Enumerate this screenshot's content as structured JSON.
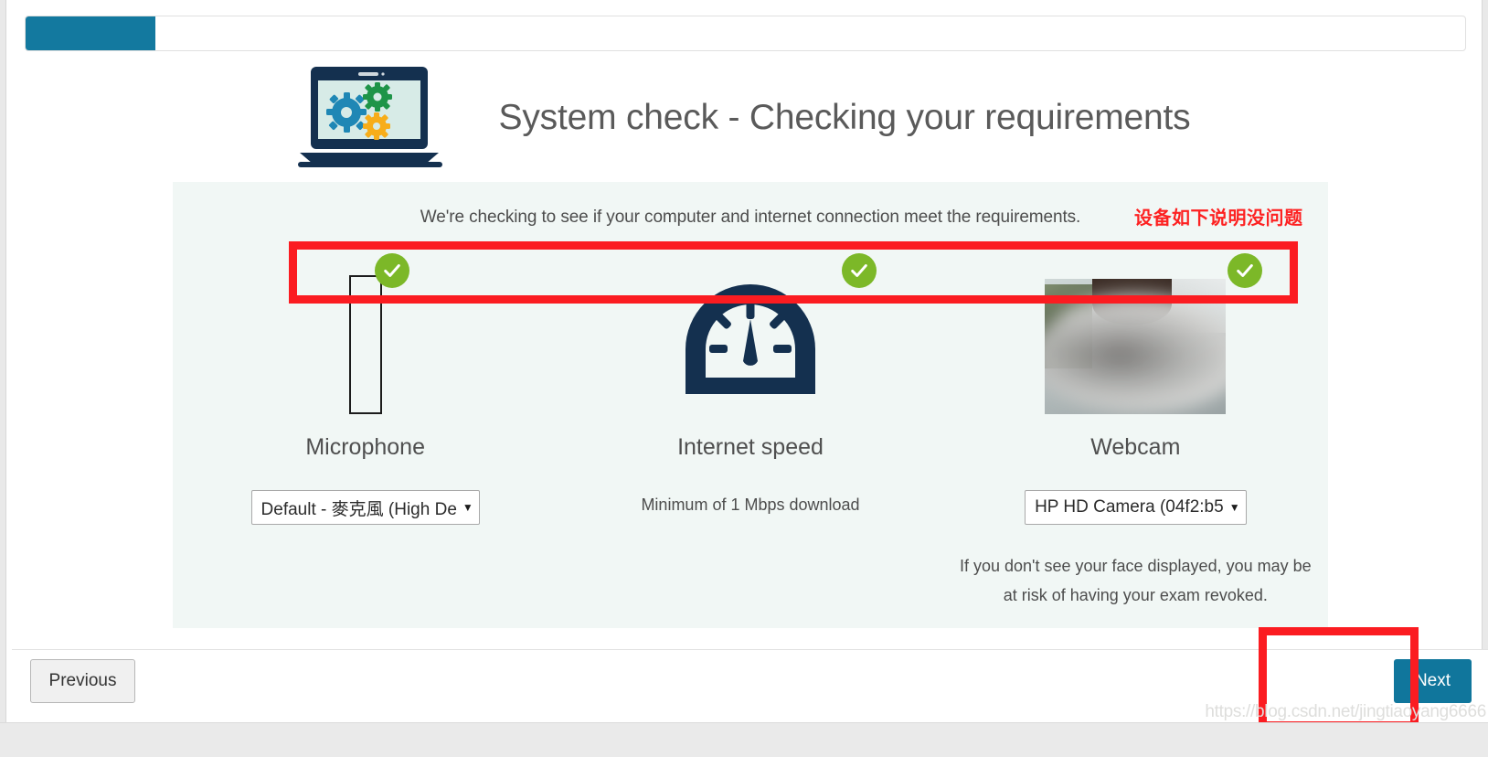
{
  "progress": {
    "percent": 9,
    "fill_color": "#13799f"
  },
  "header": {
    "title": "System check - Checking your requirements",
    "icon": "laptop-gears-icon"
  },
  "panel": {
    "intro": "We're checking to see if your computer and internet connection meet the requirements.",
    "annotation_zh": "设备如下说明没问题",
    "annotation_color": "#fd2222"
  },
  "checks": [
    {
      "id": "microphone",
      "title": "Microphone",
      "icon": "microphone-level-meter-icon",
      "status": "pass",
      "status_icon": "green-check-icon",
      "select_value": "Default - 麥克風 (High De",
      "note": ""
    },
    {
      "id": "internet-speed",
      "title": "Internet speed",
      "icon": "speedometer-icon",
      "status": "pass",
      "status_icon": "green-check-icon",
      "note": "Minimum of 1 Mbps download"
    },
    {
      "id": "webcam",
      "title": "Webcam",
      "icon": "webcam-preview",
      "status": "pass",
      "status_icon": "green-check-icon",
      "select_value": "HP HD Camera (04f2:b5",
      "note": "If you don't see your face displayed, you may be at risk of having your exam revoked."
    }
  ],
  "footer": {
    "previous_label": "Previous",
    "next_label": "Next",
    "next_color": "#10769c"
  },
  "watermark": "https://blog.csdn.net/jingtiaoyang6666"
}
